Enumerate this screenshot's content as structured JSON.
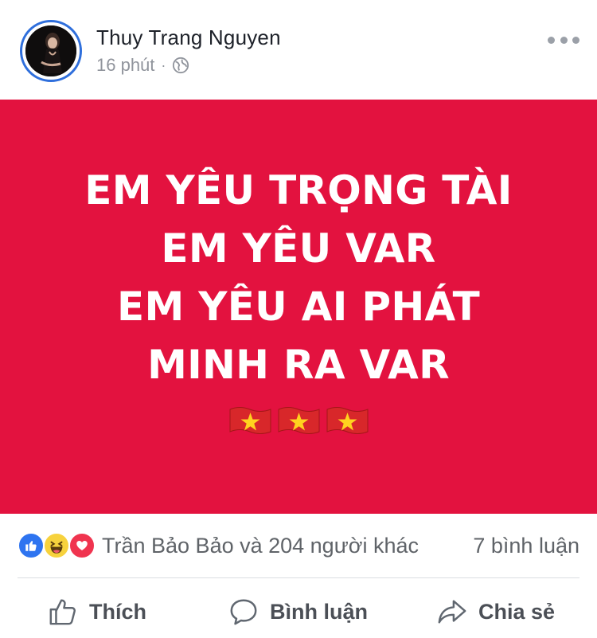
{
  "post": {
    "author": "Thuy Trang Nguyen",
    "time": "16 phút",
    "separator": "·",
    "privacy_icon": "globe-icon",
    "more_icon": "more-horizontal-icon"
  },
  "card": {
    "background": "#e3123f",
    "text_color": "#ffffff",
    "lines": [
      "EM YÊU TRỌNG TÀI",
      "EM YÊU VAR",
      "EM YÊU AI PHÁT",
      "MINH RA VAR"
    ],
    "emoji": [
      "vietnam-flag-icon",
      "vietnam-flag-icon",
      "vietnam-flag-icon"
    ]
  },
  "reactions": {
    "icons": [
      "like-reaction-icon",
      "haha-reaction-icon",
      "love-reaction-icon"
    ],
    "summary": "Trần Bảo Bảo và 204 người khác",
    "comments": "7 bình luận"
  },
  "actions": {
    "like": "Thích",
    "comment": "Bình luận",
    "share": "Chia sẻ"
  },
  "colors": {
    "like_blue": "#2e74f0",
    "love_red": "#f0344f",
    "haha_yellow": "#f7d23d",
    "muted_text": "#5f6368",
    "avatar_ring": "#2f6fdc"
  }
}
